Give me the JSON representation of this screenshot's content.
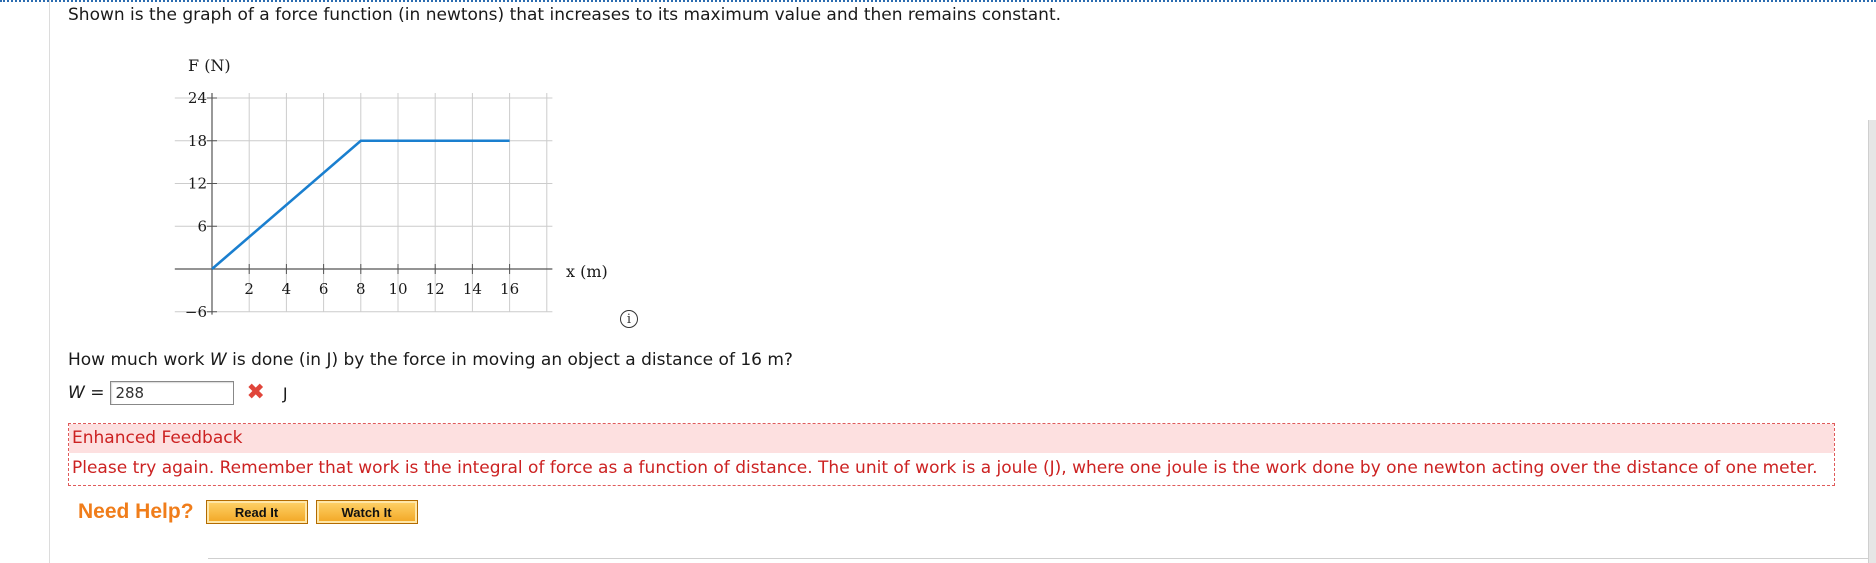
{
  "prompt": "Shown is the graph of a force function (in newtons) that increases to its maximum value and then remains constant.",
  "graph": {
    "y_axis_label": "F (N)",
    "x_axis_label": "x (m)",
    "y_ticks": [
      "24",
      "18",
      "12",
      "6",
      "−6"
    ],
    "x_ticks": [
      "2",
      "4",
      "6",
      "8",
      "10",
      "12",
      "14",
      "16"
    ],
    "line_color": "#1a7fcf"
  },
  "chart_data": {
    "type": "line",
    "series": [
      {
        "x": [
          0,
          8,
          16
        ],
        "y": [
          0,
          18,
          18
        ]
      }
    ],
    "xlabel": "x (m)",
    "ylabel": "F (N)",
    "xlim": [
      0,
      18
    ],
    "ylim": [
      -6,
      24
    ],
    "grid": true
  },
  "info_icon": "info-icon",
  "question": {
    "before": "How much work ",
    "var": "W",
    "after": " is done (in J) by the force in moving an object a distance of 16 m?"
  },
  "answer": {
    "var": "W",
    "equals": " =",
    "value": "288",
    "status": "incorrect",
    "unit": "J"
  },
  "feedback": {
    "title": "Enhanced Feedback",
    "text": "Please try again. Remember that work is the integral of force as a function of distance. The unit of work is a joule (J), where one joule is the work done by one newton acting over the distance of one meter."
  },
  "help": {
    "label": "Need Help?",
    "read_it": "Read It",
    "watch_it": "Watch It"
  }
}
